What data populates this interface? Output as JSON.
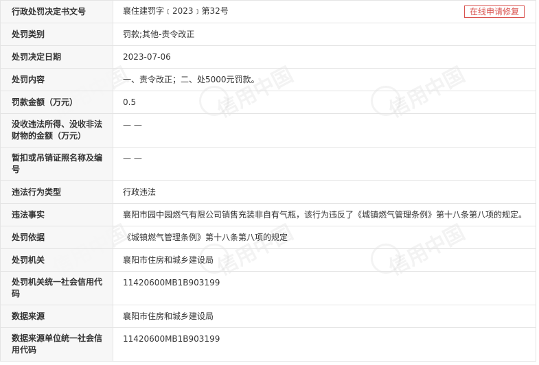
{
  "watermark": {
    "text": "信用中国"
  },
  "repair_button": {
    "label": "在线申请修复"
  },
  "rows": [
    {
      "label": "行政处罚决定书文号",
      "value": "襄住建罚字﹝2023﹞第32号"
    },
    {
      "label": "处罚类别",
      "value": "罚款;其他-责令改正"
    },
    {
      "label": "处罚决定日期",
      "value": "2023-07-06"
    },
    {
      "label": "处罚内容",
      "value": "一、责令改正；二、处5000元罚款。"
    },
    {
      "label": "罚款金额（万元）",
      "value": "0.5"
    },
    {
      "label": "没收违法所得、没收非法财物的金额（万元）",
      "value": "— —"
    },
    {
      "label": "暂扣或吊销证照名称及编号",
      "value": "— —"
    },
    {
      "label": "违法行为类型",
      "value": "行政违法"
    },
    {
      "label": "违法事实",
      "value": "襄阳市园中园燃气有限公司销售充装非自有气瓶，该行为违反了《城镇燃气管理条例》第十八条第八项的规定。"
    },
    {
      "label": "处罚依据",
      "value": "《城镇燃气管理条例》第十八条第八项的规定"
    },
    {
      "label": "处罚机关",
      "value": "襄阳市住房和城乡建设局"
    },
    {
      "label": "处罚机关统一社会信用代码",
      "value": "11420600MB1B903199"
    },
    {
      "label": "数据来源",
      "value": "襄阳市住房和城乡建设局"
    },
    {
      "label": "数据来源单位统一社会信用代码",
      "value": "11420600MB1B903199"
    }
  ]
}
